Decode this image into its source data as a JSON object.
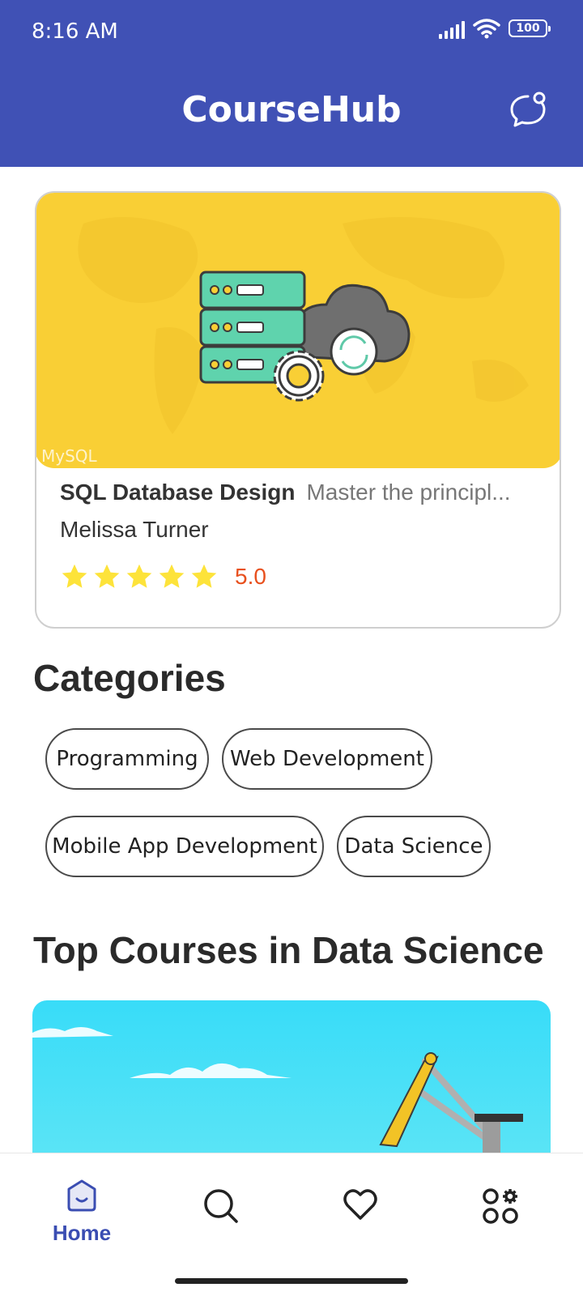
{
  "status_bar": {
    "time": "8:16 AM",
    "battery": "100"
  },
  "app_bar": {
    "title": "CourseHub",
    "chat_icon": "chat-bubble-icon"
  },
  "featured_course": {
    "title": "SQL Database Design",
    "description": "Master the principl...",
    "instructor": "Melissa Turner",
    "rating": "5.0",
    "stars": 5,
    "image_watermark": "MySQL"
  },
  "categories": {
    "heading": "Categories",
    "items": [
      "Programming",
      "Web Development",
      "Mobile App Development",
      "Data Science"
    ]
  },
  "top_courses": {
    "heading": "Top Courses in Data Science"
  },
  "bottom_nav": {
    "home_label": "Home",
    "home_icon": "home-icon",
    "search_icon": "search-icon",
    "favorites_icon": "heart-icon",
    "more_icon": "categories-icon"
  },
  "colors": {
    "primary": "#4051b5",
    "rating": "#e8501e",
    "star": "#fde33a",
    "hero_bg": "#f9cf35"
  }
}
